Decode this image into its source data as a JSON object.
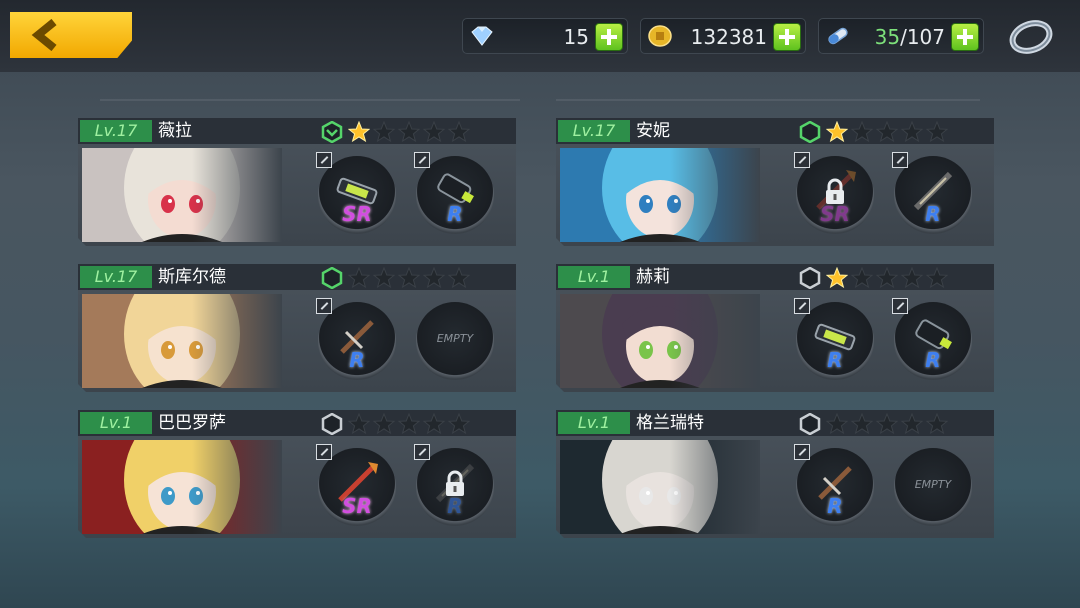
{
  "topbar": {
    "gems": "15",
    "gold": "132381",
    "stamina_current": "35",
    "stamina_max": "/107",
    "icons": {
      "back": "back-arrow-icon",
      "gems": "gem-icon",
      "gold": "gold-coin-icon",
      "stamina": "stamina-capsule-icon",
      "ring": "ring-icon"
    }
  },
  "cards": [
    {
      "level": "Lv.17",
      "name": "薇拉",
      "stars_filled": 1,
      "rank_color": "#55d46a",
      "rank_chevron": true,
      "weapons": [
        {
          "rarity": "SR",
          "state": "equipped"
        },
        {
          "rarity": "R",
          "state": "equipped"
        }
      ],
      "portrait": {
        "bg": "#c9c2c0",
        "hair": "#e8e3da",
        "eye": "#d8324a",
        "skin": "#f4dcd2"
      }
    },
    {
      "level": "Lv.17",
      "name": "安妮",
      "stars_filled": 1,
      "rank_color": "#55d46a",
      "rank_chevron": false,
      "weapons": [
        {
          "rarity": "SR",
          "state": "locked"
        },
        {
          "rarity": "R",
          "state": "equipped"
        }
      ],
      "portrait": {
        "bg": "#2d7ab0",
        "hair": "#58bde6",
        "eye": "#2f7fc0",
        "skin": "#f4e3dc"
      }
    },
    {
      "level": "Lv.17",
      "name": "斯库尔德",
      "stars_filled": 0,
      "rank_color": "#55d46a",
      "rank_chevron": false,
      "weapons": [
        {
          "rarity": "R",
          "state": "equipped"
        },
        {
          "rarity": "",
          "state": "empty",
          "empty_label": "EMPTY"
        }
      ],
      "portrait": {
        "bg": "#a47a5a",
        "hair": "#f1d598",
        "eye": "#d89a3a",
        "skin": "#f6e2cf"
      }
    },
    {
      "level": "Lv.1",
      "name": "赫莉",
      "stars_filled": 1,
      "rank_color": "#c9ced3",
      "rank_chevron": false,
      "weapons": [
        {
          "rarity": "R",
          "state": "equipped"
        },
        {
          "rarity": "R",
          "state": "equipped"
        }
      ],
      "portrait": {
        "bg": "#4d4a4e",
        "hair": "#4a3d50",
        "eye": "#7ac44a",
        "skin": "#f2ddd2"
      }
    },
    {
      "level": "Lv.1",
      "name": "巴巴罗萨",
      "stars_filled": 0,
      "rank_color": "#c9ced3",
      "rank_chevron": false,
      "weapons": [
        {
          "rarity": "SR",
          "state": "equipped"
        },
        {
          "rarity": "R",
          "state": "locked"
        }
      ],
      "portrait": {
        "bg": "#8a2020",
        "hair": "#f0d068",
        "eye": "#3e9ac8",
        "skin": "#f6e3d6"
      }
    },
    {
      "level": "Lv.1",
      "name": "格兰瑞特",
      "stars_filled": 0,
      "rank_color": "#c9ced3",
      "rank_chevron": false,
      "weapons": [
        {
          "rarity": "R",
          "state": "equipped"
        },
        {
          "rarity": "",
          "state": "empty",
          "empty_label": "EMPTY"
        }
      ],
      "portrait": {
        "bg": "#1e2930",
        "hair": "#d8d6d0",
        "eye": "#e8e8e8",
        "skin": "#e8e2de"
      }
    }
  ]
}
